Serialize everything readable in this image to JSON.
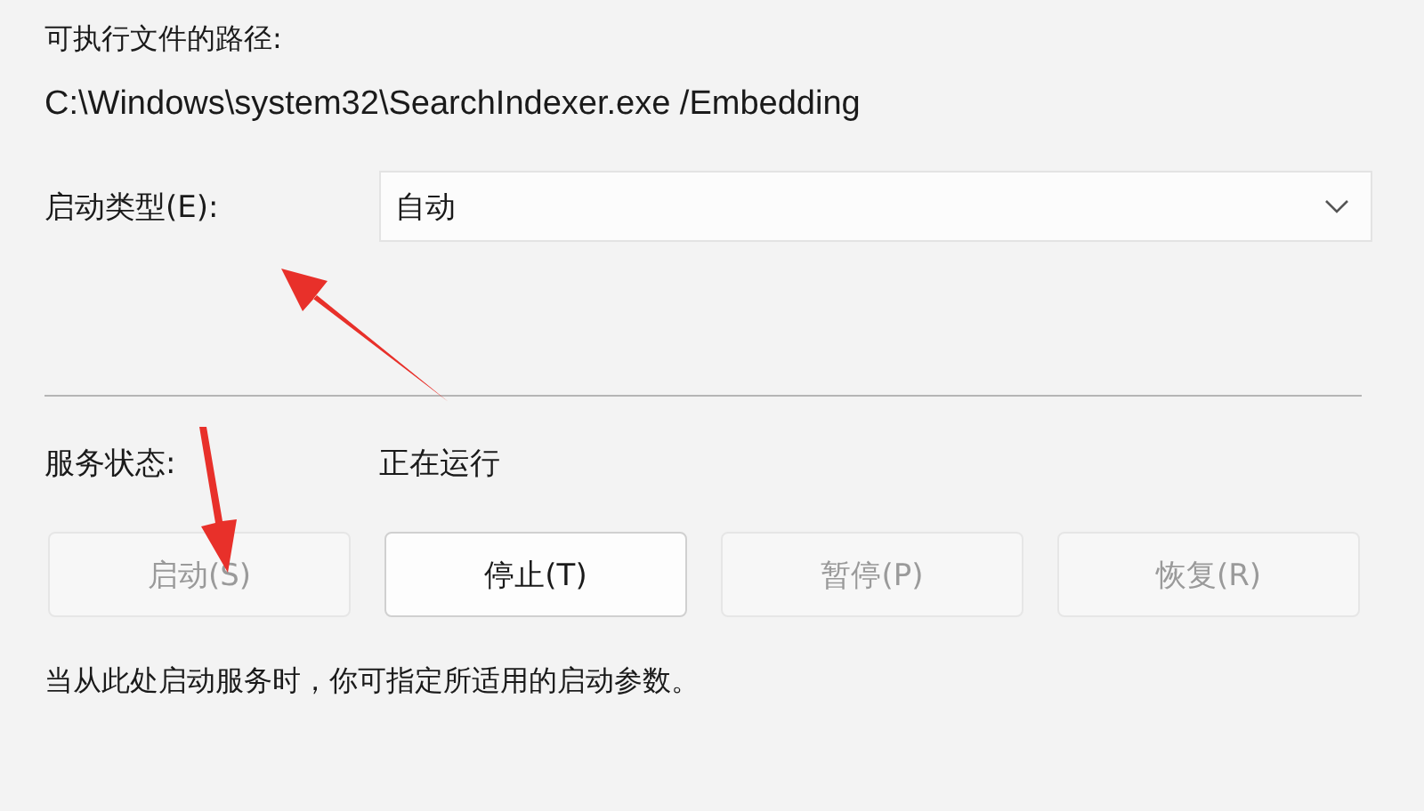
{
  "path_label": "可执行文件的路径:",
  "path_value": "C:\\Windows\\system32\\SearchIndexer.exe /Embedding",
  "startup_type": {
    "label": "启动类型(E):",
    "value": "自动"
  },
  "service_status": {
    "label": "服务状态:",
    "value": "正在运行"
  },
  "buttons": [
    {
      "label": "启动(S)",
      "disabled": true
    },
    {
      "label": "停止(T)",
      "disabled": false
    },
    {
      "label": "暂停(P)",
      "disabled": true
    },
    {
      "label": "恢复(R)",
      "disabled": true
    }
  ],
  "hint": "当从此处启动服务时，你可指定所适用的启动参数。"
}
